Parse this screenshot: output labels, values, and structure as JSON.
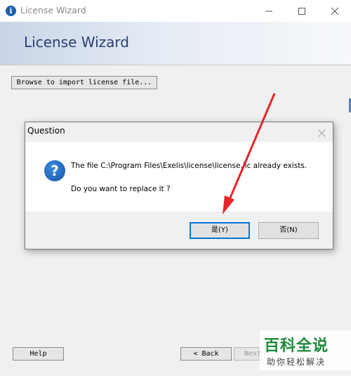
{
  "window": {
    "title": "License Wizard",
    "banner_title": "License Wizard"
  },
  "main": {
    "import_button": "Browse to import license file...",
    "help_button": "Help",
    "back_button": "< Back",
    "next_button": "Next >"
  },
  "dialog": {
    "title": "Question",
    "message_line1": "The file C:\\Program Files\\Exelis\\license\\license.lic already exists.",
    "message_line2": "Do you want to replace it ?",
    "yes_button": "是(Y)",
    "no_button": "否(N)"
  },
  "watermark": {
    "title": "百科全说",
    "subtitle": "助你轻松解决"
  },
  "colors": {
    "accent": "#0078d7",
    "annotation_arrow": "#e8232a",
    "banner_title": "#2b3f72"
  }
}
